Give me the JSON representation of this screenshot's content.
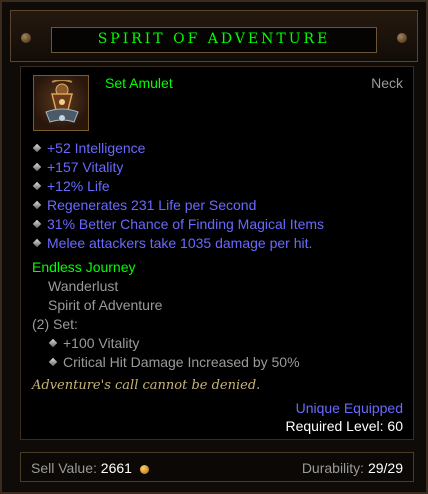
{
  "title": "SPIRIT OF ADVENTURE",
  "item": {
    "type": "Set Amulet",
    "slot": "Neck"
  },
  "stats": [
    "+52 Intelligence",
    "+157 Vitality",
    "+12% Life",
    "Regenerates 231 Life per Second",
    "31% Better Chance of Finding Magical Items",
    "Melee attackers take 1035 damage per hit."
  ],
  "set": {
    "name": "Endless Journey",
    "pieces": [
      "Wanderlust",
      "Spirit of Adventure"
    ],
    "bonus_header": "(2) Set:",
    "bonuses": [
      "+100 Vitality",
      "Critical Hit Damage Increased by 50%"
    ]
  },
  "flavor": "Adventure's call cannot be denied.",
  "equip": {
    "unique": "Unique Equipped",
    "required_level": "Required Level: 60"
  },
  "footer": {
    "sell_label": "Sell Value:",
    "sell_value": "2661",
    "durability_label": "Durability:",
    "durability_value": "29/29"
  },
  "icons": {
    "item": "amulet-icon",
    "currency": "gold-coin-icon"
  },
  "colors": {
    "title": "#00ff00",
    "magic_stat": "#6969ff",
    "set_name": "#00ff00",
    "flavor": "#c7b377",
    "muted": "#9a9a9a"
  }
}
